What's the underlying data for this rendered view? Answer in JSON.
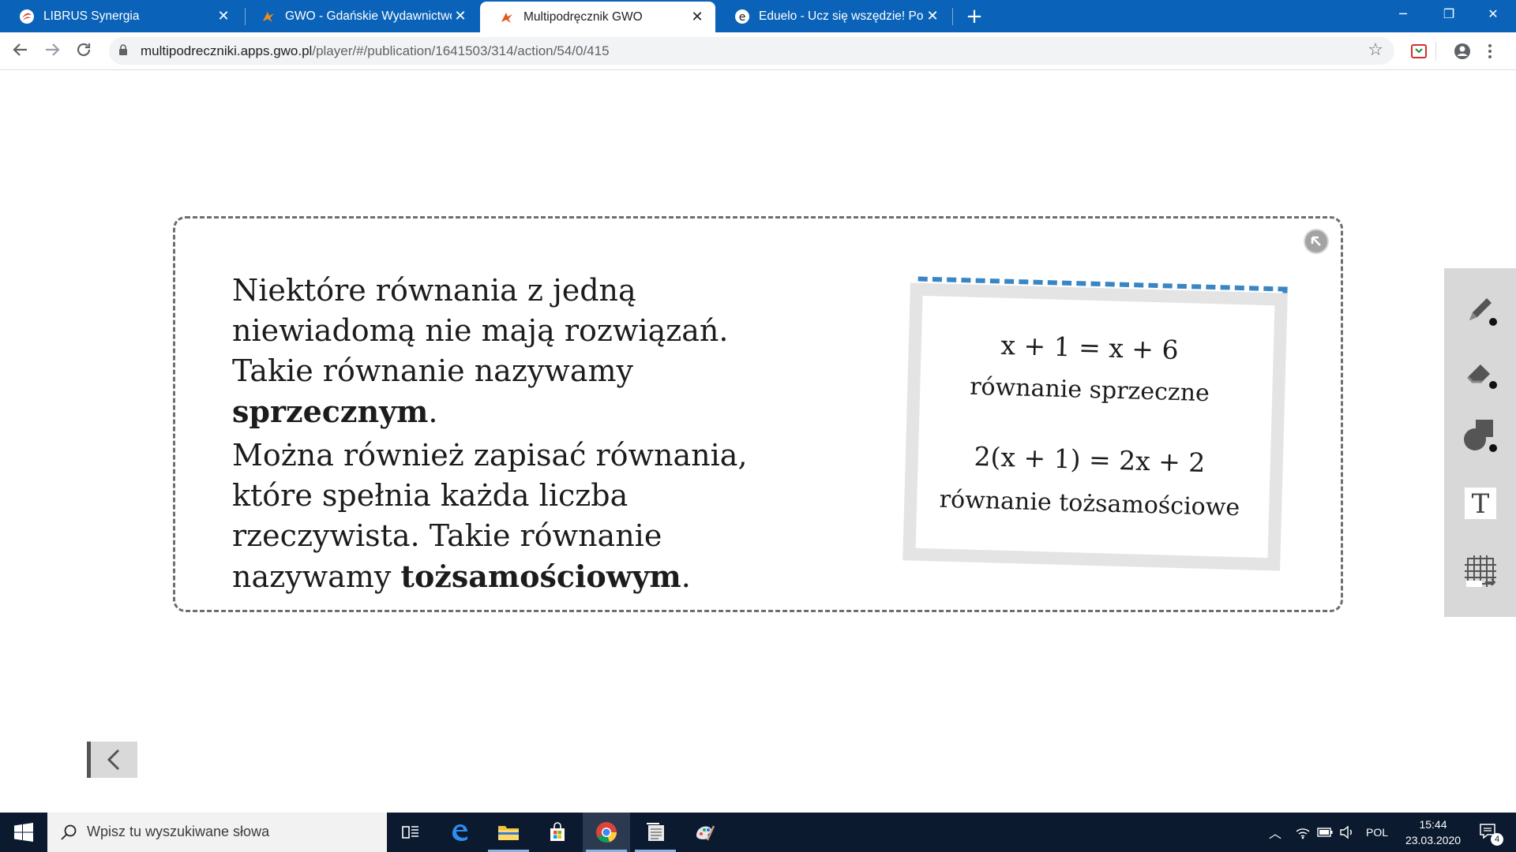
{
  "browser": {
    "tabs": [
      {
        "title": "LIBRUS Synergia",
        "favicon": "librus-icon"
      },
      {
        "title": "GWO - Gdańskie Wydawnictwo O",
        "favicon": "gwo-icon"
      },
      {
        "title": "Multipodręcznik GWO",
        "favicon": "gwo-icon"
      },
      {
        "title": "Eduelo - Ucz się wszędzie! Poszer",
        "favicon": "eduelo-icon"
      }
    ],
    "active_tab_index": 2,
    "url_host": "multipodreczniki.apps.gwo.pl",
    "url_path": "/player/#/publication/1641503/314/action/54/0/415"
  },
  "content": {
    "para1": {
      "text": "Niektóre równania z jedną niewiadomą nie mają rozwiązań. Takie równanie nazywamy ",
      "bold": "sprzecznym",
      "end": "."
    },
    "para2": {
      "text": "Można również zapisać równania, które spełnia każda liczba rzeczywista. Takie równanie nazywamy ",
      "bold": "tożsamościowym",
      "end": "."
    },
    "note": {
      "eq1": "x + 1 = x + 6",
      "label1": "równanie sprzeczne",
      "eq2": "2(x + 1) = 2x + 2",
      "label2": "równanie tożsamościowe"
    }
  },
  "palette": {
    "tools": [
      "pen-icon",
      "eraser-icon",
      "shapes-icon",
      "text-tool-icon",
      "grid-icon"
    ],
    "text_tool_glyph": "T"
  },
  "taskbar": {
    "search_placeholder": "Wpisz tu wyszukiwane słowa",
    "language": "POL",
    "time": "15:44",
    "date": "23.03.2020",
    "notification_count": "4"
  },
  "colors": {
    "tabstrip": "#0a63b8",
    "note_dash": "#3a86c4",
    "taskbar": "#0b1a2f"
  }
}
